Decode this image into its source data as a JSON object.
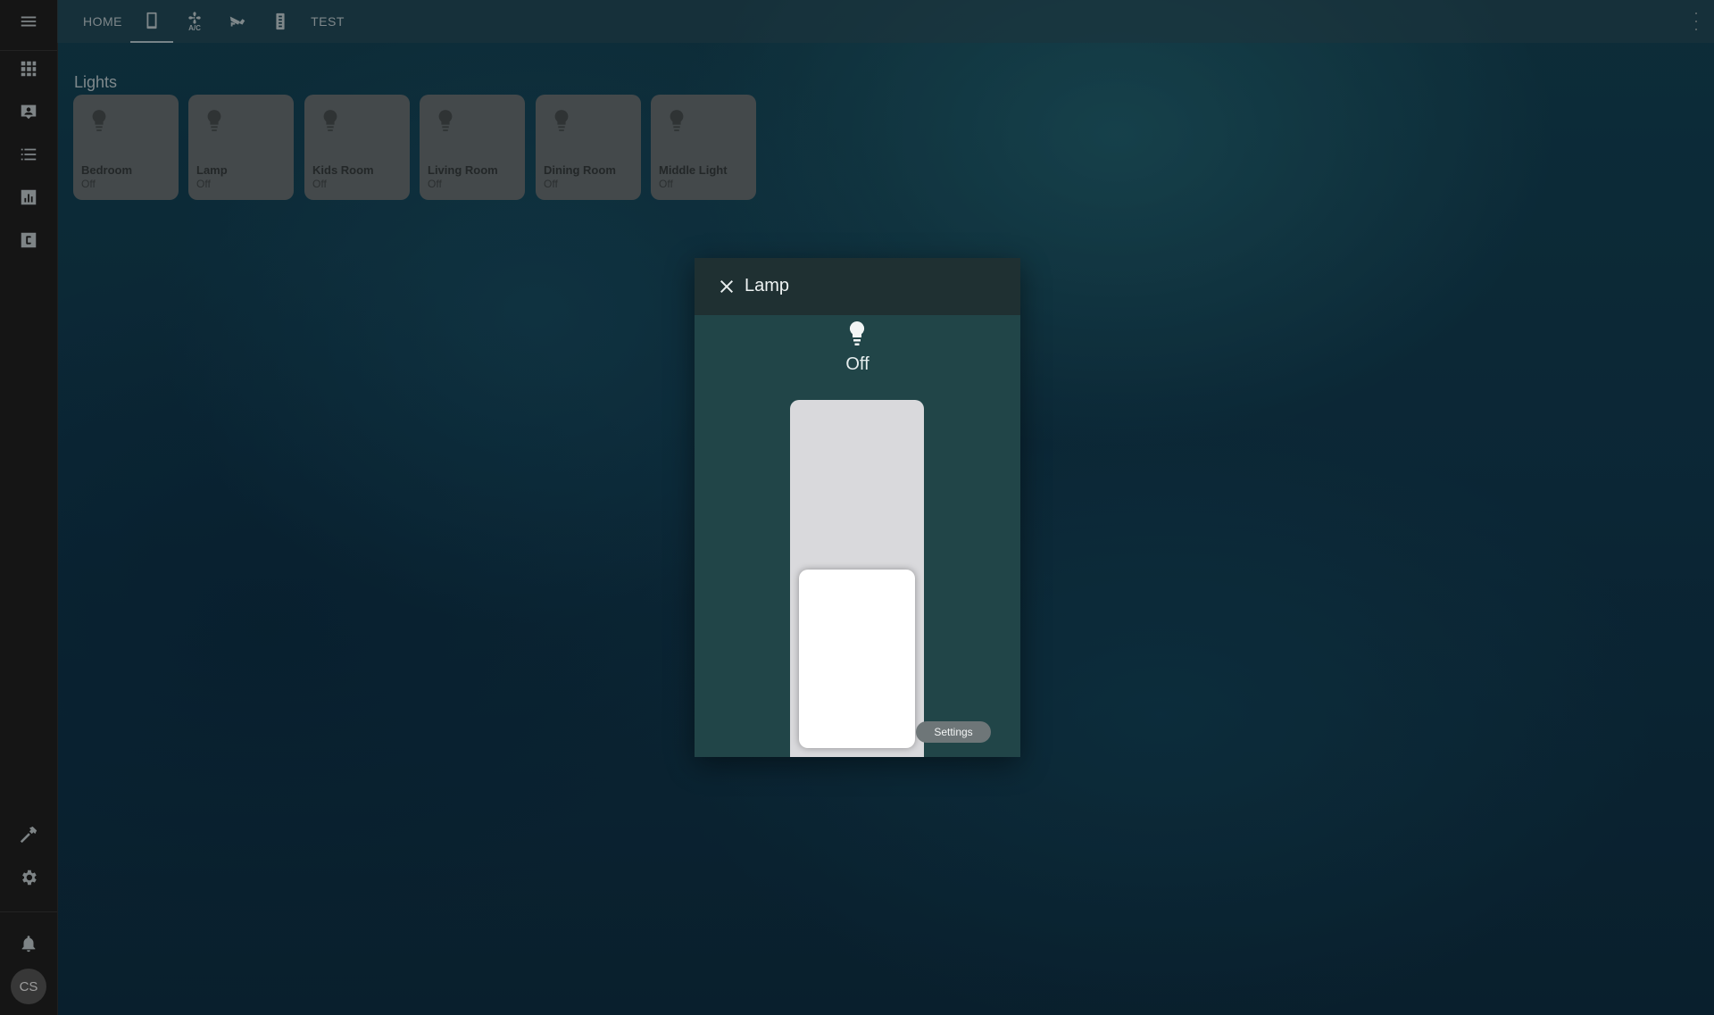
{
  "sidebar": {
    "items": [
      {
        "icon": "menu-icon"
      },
      {
        "icon": "dashboard-grid-icon"
      },
      {
        "icon": "account-box-icon"
      },
      {
        "icon": "list-icon"
      },
      {
        "icon": "chart-box-icon"
      },
      {
        "icon": "c-box-icon"
      },
      {
        "icon": "hammer-icon"
      },
      {
        "icon": "gear-icon"
      },
      {
        "icon": "bell-icon"
      }
    ],
    "avatar_initials": "CS"
  },
  "topbar": {
    "tabs": [
      {
        "label": "HOME"
      },
      {
        "icon": "tablet-icon",
        "active": true
      },
      {
        "icon": "air-conditioner-icon",
        "label": "A/C"
      },
      {
        "icon": "cctv-icon"
      },
      {
        "icon": "remote-control-icon"
      },
      {
        "label": "TEST"
      }
    ]
  },
  "lights": {
    "title": "Lights",
    "cards": [
      {
        "name": "Bedroom",
        "state": "Off"
      },
      {
        "name": "Lamp",
        "state": "Off"
      },
      {
        "name": "Kids Room",
        "state": "Off"
      },
      {
        "name": "Living Room",
        "state": "Off"
      },
      {
        "name": "Dining Room",
        "state": "Off"
      },
      {
        "name": "Middle Light",
        "state": "Off"
      }
    ]
  },
  "dialog": {
    "title": "Lamp",
    "state": "Off",
    "brightness_percent": 0,
    "settings_label": "Settings"
  }
}
